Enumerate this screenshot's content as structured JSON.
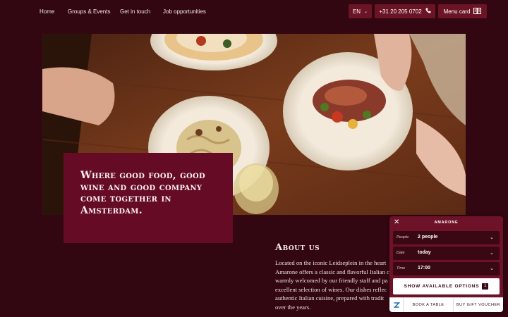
{
  "nav": {
    "links": [
      "Home",
      "Groups & Events",
      "Get in touch",
      "Job opportunities"
    ],
    "language": "EN",
    "phone": "+31 20 205 0702",
    "menu_card": "Menu card"
  },
  "hero": {
    "tagline": "Where good food, good wine and good company come together in Amsterdam."
  },
  "about": {
    "title": "About us",
    "text": "Located on the iconic Leidseplein in the heart\nAmarone offers a classic and flavorful Italian c\nwarmly welcomed by our friendly staff and pa\nexcellent selection of wines. Our dishes reflec\nauthentic Italian cuisine, prepared with tradit\nover the years."
  },
  "widget": {
    "title": "AMARONE",
    "close_icon": "close-icon",
    "rows": [
      {
        "label": "People",
        "value": "2 people"
      },
      {
        "label": "Date",
        "value": "today"
      },
      {
        "label": "Time",
        "value": "17:00"
      }
    ],
    "show_label": "SHOW AVAILABLE OPTIONS",
    "show_count": "1",
    "book_label": "BOOK A TABLE",
    "gift_label": "BUY GIFT VOUCHER",
    "logo_icon": "zenchef-logo-icon"
  },
  "colors": {
    "page_bg": "#320711",
    "accent": "#650b25",
    "button_bg": "#6b1426"
  }
}
